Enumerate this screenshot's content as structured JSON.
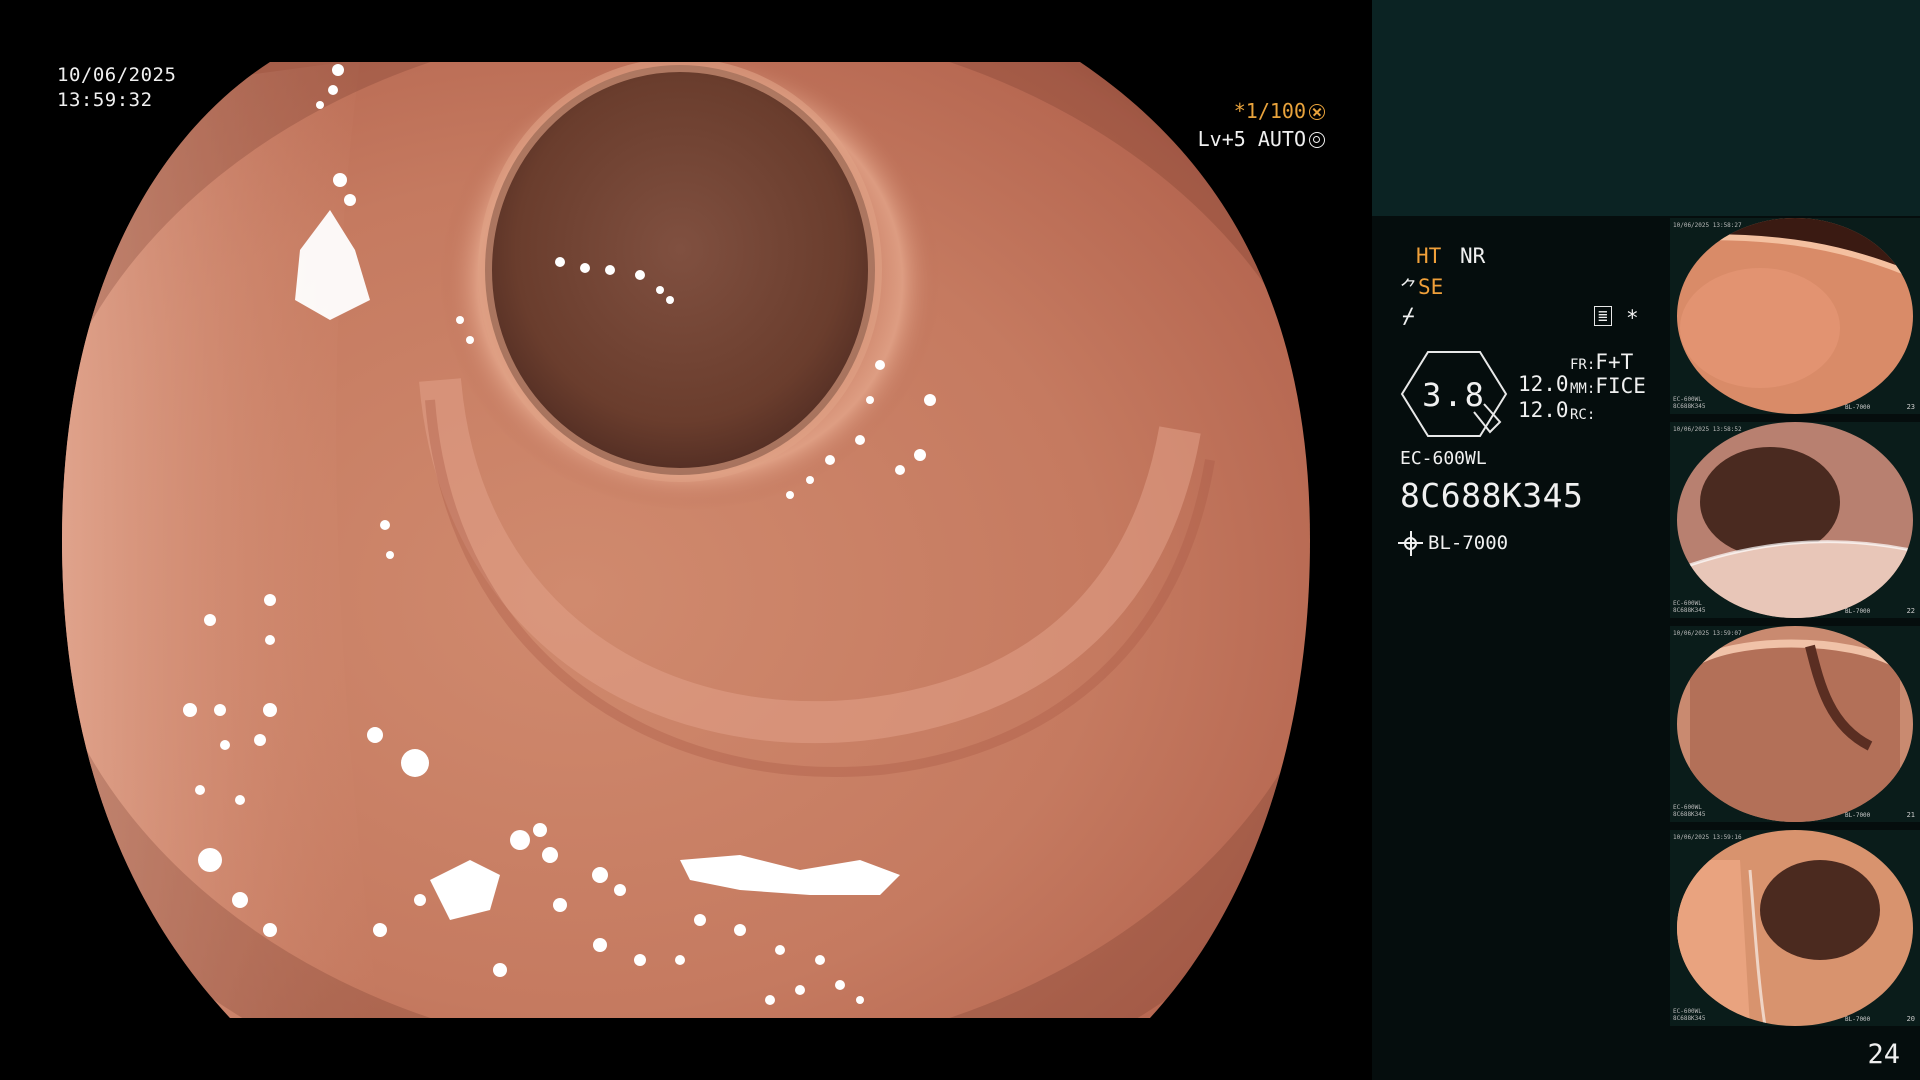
{
  "overlay": {
    "date": "10/06/2025",
    "time": "13:59:32",
    "shutter": "*1/100",
    "level": "Lv+5 AUTO"
  },
  "panel": {
    "mode_ht": "HT",
    "mode_nr": "NR",
    "mode_se": "SE",
    "edge_symbol": "⌿",
    "star": "*",
    "zoom_value": "3.8",
    "val1": "12.0",
    "val2": "12.0",
    "fr_label": "FR:",
    "fr_value": "F+T",
    "mm_label": "MM:",
    "mm_value": "FICE",
    "rc_label": "RC:",
    "scope_model": "EC-600WL",
    "serial": "8C688K345",
    "light_source": "BL-7000",
    "page_number": "24"
  },
  "thumbnails": [
    {
      "number": "23",
      "ts": "10/06/2025 13:58:27",
      "model": "EC-600WL",
      "serial": "8C688K345",
      "light": "BL-7000",
      "scene": "wall"
    },
    {
      "number": "22",
      "ts": "10/06/2025 13:58:52",
      "model": "EC-600WL",
      "serial": "8C688K345",
      "light": "BL-7000",
      "scene": "lumen"
    },
    {
      "number": "21",
      "ts": "10/06/2025 13:59:07",
      "model": "EC-600WL",
      "serial": "8C688K345",
      "light": "BL-7000",
      "scene": "fold"
    },
    {
      "number": "20",
      "ts": "10/06/2025 13:59:16",
      "model": "EC-600WL",
      "serial": "8C688K345",
      "light": "BL-7000",
      "scene": "lumen2"
    }
  ],
  "colors": {
    "mucosa": "#c2765e",
    "mucosa_light": "#e4a68c",
    "lumen": "#6b3b2b",
    "panel_bg": "#050d0d",
    "panel_top": "#0b2323",
    "accent_orange": "#f0a03a"
  }
}
